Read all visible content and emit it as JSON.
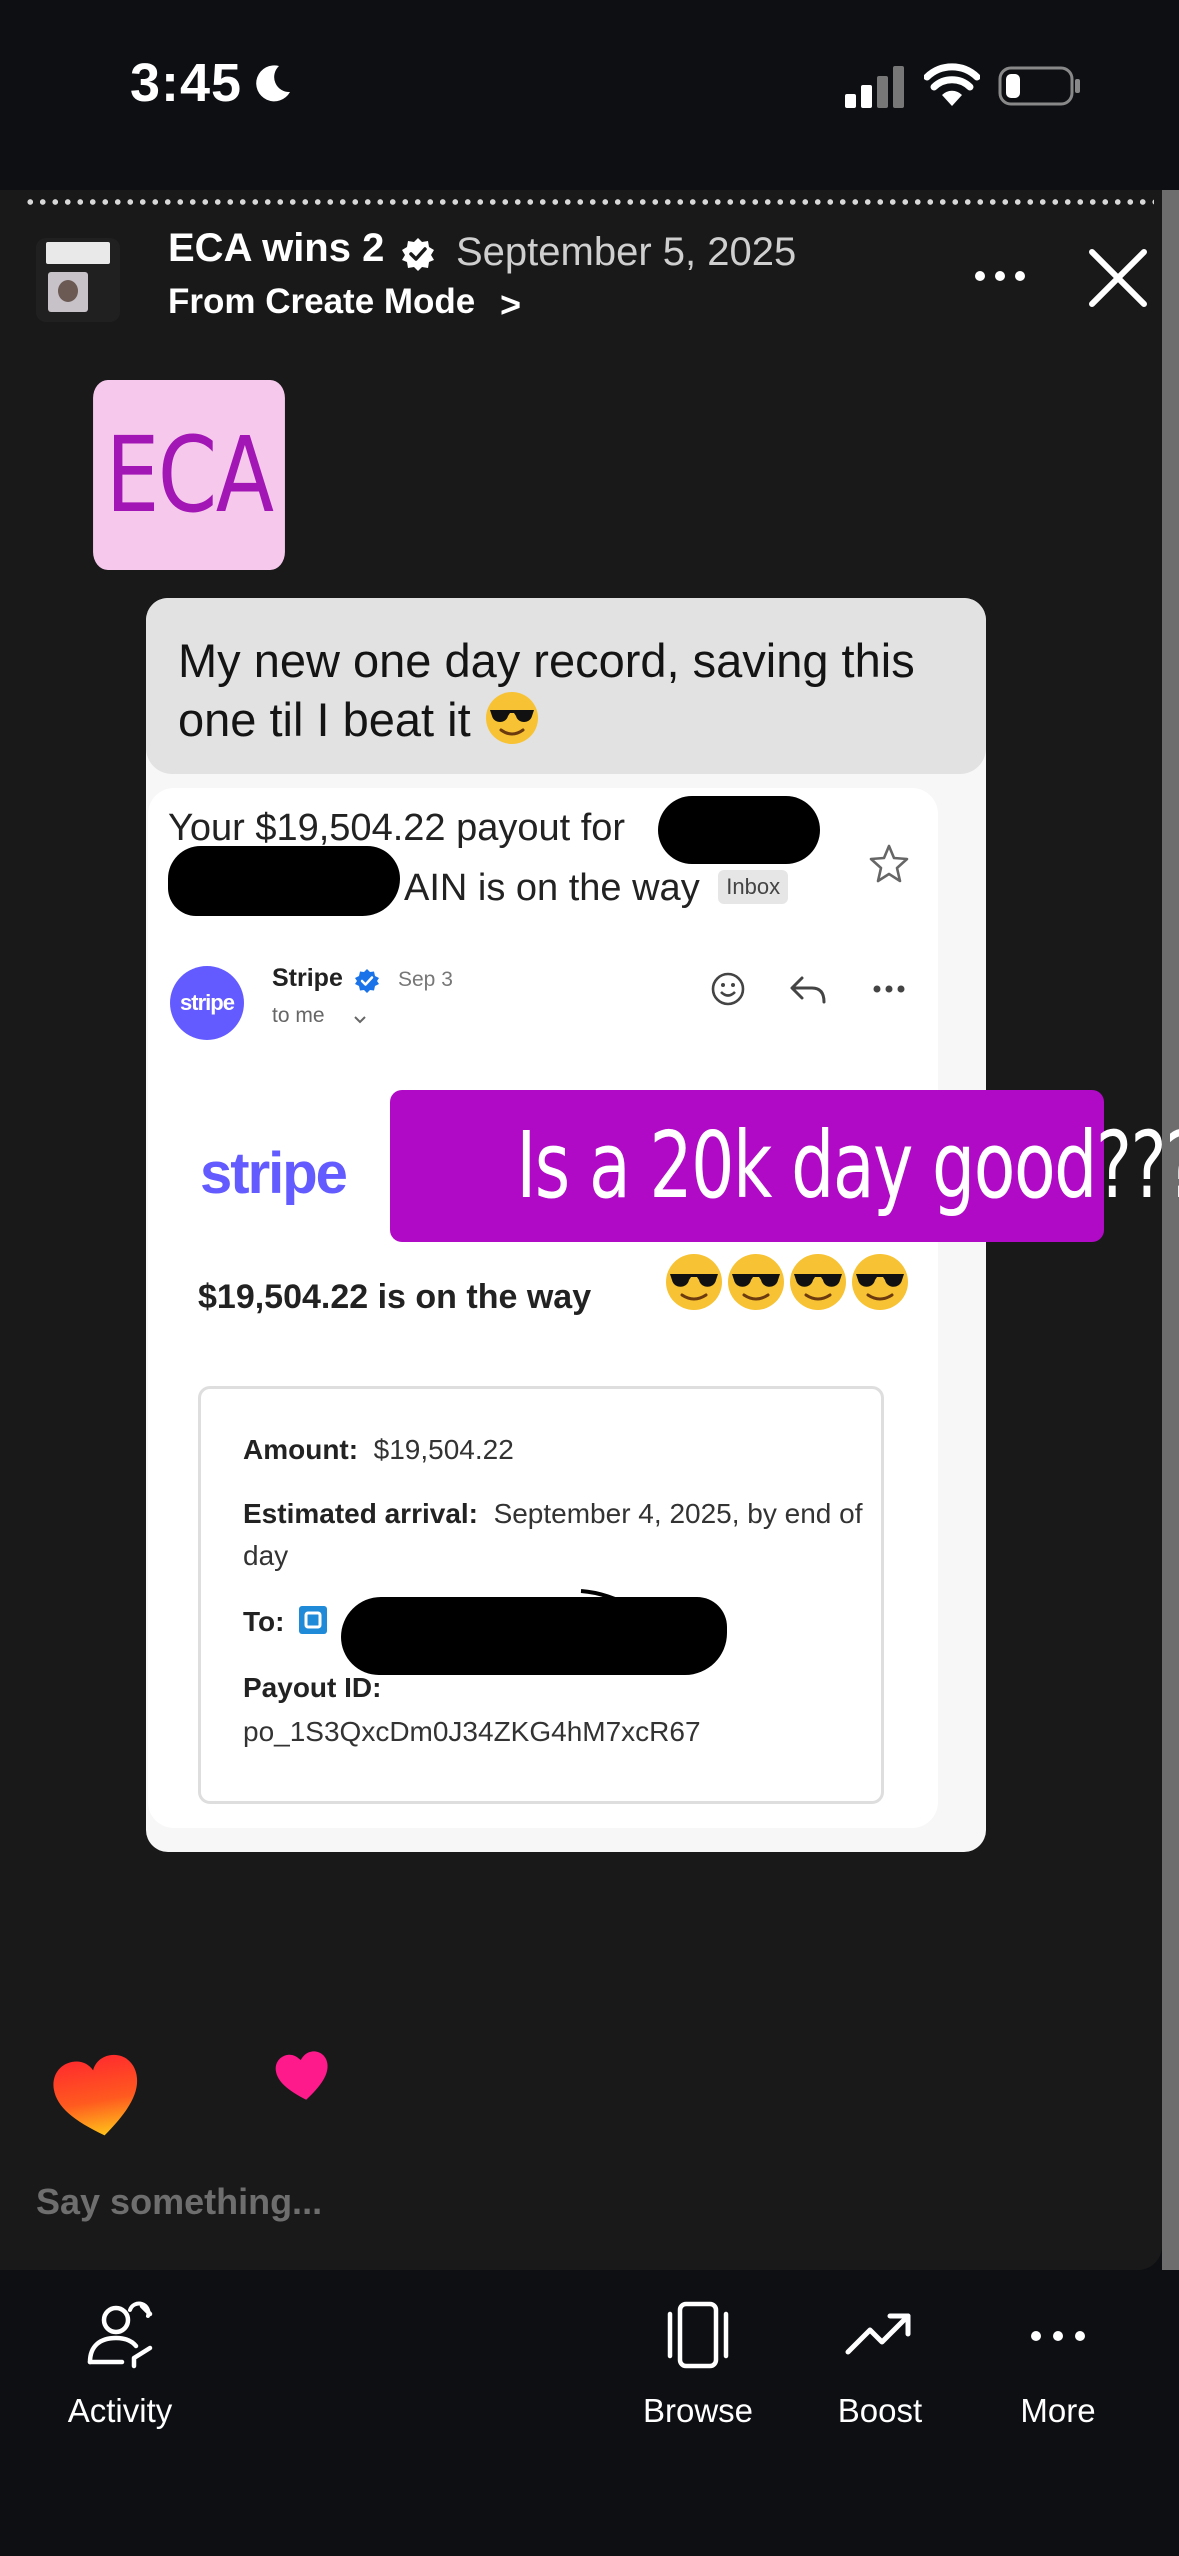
{
  "status_bar": {
    "time": "3:45"
  },
  "story": {
    "title": "ECA wins 2",
    "date": "September 5, 2025",
    "source": "From Create Mode",
    "source_chevron": ">"
  },
  "stickers": {
    "eca": "ECA",
    "question": "Is a 20k day good????"
  },
  "caption": {
    "text": "My new one day record, saving this one til I beat it"
  },
  "email": {
    "subject_part1": "Your $19,504.22 payout for ",
    "subject_part2": "AIN is on the way",
    "inbox_badge": "Inbox",
    "sender_avatar": "stripe",
    "sender": "Stripe",
    "date": "Sep 3",
    "to": "to me",
    "logo": "stripe",
    "headline": "$19,504.22 is on the way",
    "amount_label": "Amount:",
    "amount_value": "$19,504.22",
    "arrival_label": "Estimated arrival:",
    "arrival_value": "September 4, 2025, by end of day",
    "to_label": "To:",
    "payout_label": "Payout ID:",
    "payout_value": "po_1S3QxcDm0J34ZKG4hM7xcR67"
  },
  "input": {
    "placeholder": "Say something..."
  },
  "nav": {
    "activity": "Activity",
    "browse": "Browse",
    "boost": "Boost",
    "more": "More"
  },
  "colors": {
    "stripe": "#635bff",
    "question_sticker": "#b10ac6",
    "eca_sticker_bg": "#f6c8ec",
    "eca_sticker_text": "#a316b6"
  }
}
